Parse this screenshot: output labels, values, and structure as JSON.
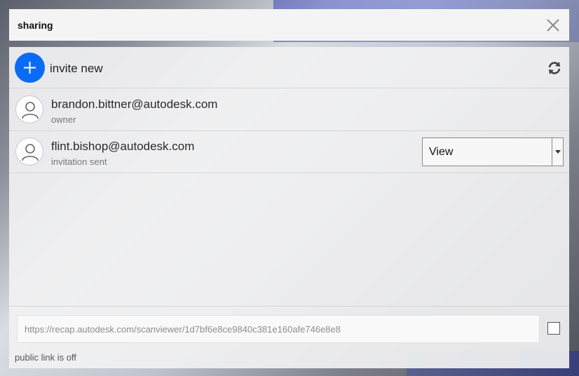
{
  "header": {
    "title": "sharing",
    "close_icon": "close-icon"
  },
  "invite": {
    "label": "invite new",
    "add_icon": "plus-icon",
    "refresh_icon": "refresh-icon"
  },
  "users": [
    {
      "email": "brandon.bittner@autodesk.com",
      "status": "owner"
    },
    {
      "email": "flint.bishop@autodesk.com",
      "status": "invitation sent",
      "permission": "View"
    }
  ],
  "public_link": {
    "url": "https://recap.autodesk.com/scanviewer/1d7bf6e8ce9840c381e160afe746e8e8",
    "checked": false,
    "status": "public link is off"
  },
  "colors": {
    "accent": "#0a6cf5"
  }
}
